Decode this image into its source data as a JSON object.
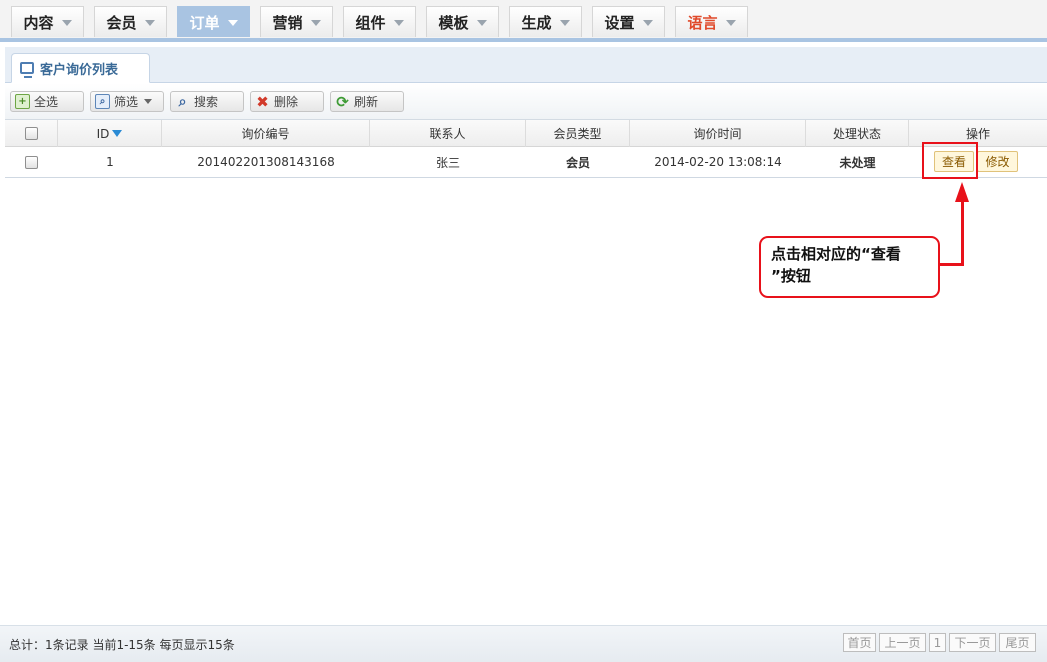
{
  "nav": {
    "items": [
      {
        "label": "内容"
      },
      {
        "label": "会员"
      },
      {
        "label": "订单"
      },
      {
        "label": "营销"
      },
      {
        "label": "组件"
      },
      {
        "label": "模板"
      },
      {
        "label": "生成"
      },
      {
        "label": "设置"
      },
      {
        "label": "语言"
      }
    ],
    "active_index": 2,
    "highlight_color": "#a9c4e2",
    "language_color": "#e04a2b"
  },
  "panel": {
    "tab_label": "客户询价列表"
  },
  "toolbar": {
    "select_all": "全选",
    "filter": "筛选",
    "search": "搜索",
    "delete": "删除",
    "refresh": "刷新"
  },
  "table": {
    "columns": [
      "ID",
      "询价编号",
      "联系人",
      "会员类型",
      "询价时间",
      "处理状态",
      "操作"
    ],
    "rows": [
      {
        "id": "1",
        "inquiry_no": "201402201308143168",
        "contact": "张三",
        "member_type": "会员",
        "time": "2014-02-20 13:08:14",
        "status": "未处理",
        "view_label": "查看",
        "edit_label": "修改"
      }
    ]
  },
  "annotation": {
    "line1": "点击相对应的“查看",
    "line2": "”按钮",
    "color": "#e8111a"
  },
  "footer": {
    "summary": "总计：1条记录 当前1-15条 每页显示15条",
    "first": "首页",
    "prev": "上一页",
    "page": "1",
    "next": "下一页",
    "last": "尾页"
  }
}
